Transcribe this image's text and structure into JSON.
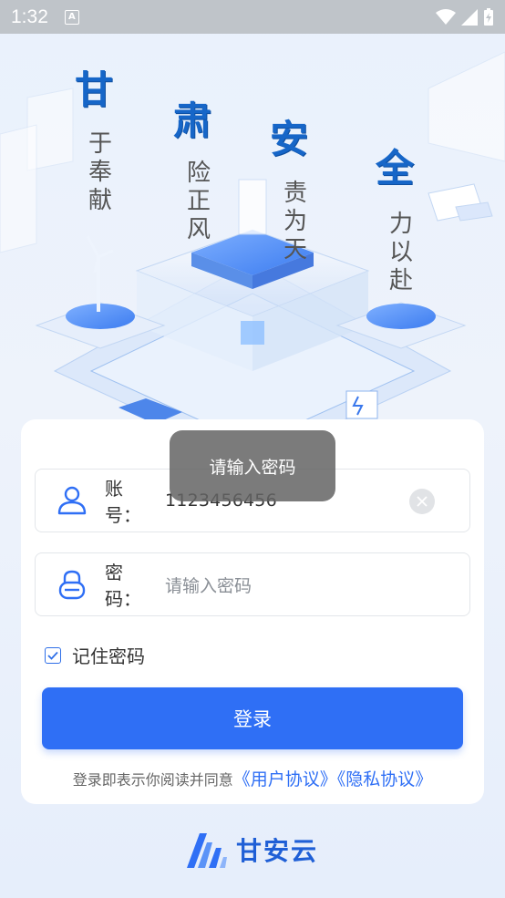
{
  "status_bar": {
    "time": "1:32",
    "notification_icon": "A"
  },
  "slogans": [
    {
      "brush": "甘",
      "text": [
        "于",
        "奉",
        "献"
      ]
    },
    {
      "brush": "肃",
      "text": [
        "险",
        "正",
        "风"
      ]
    },
    {
      "brush": "安",
      "text": [
        "责",
        "为",
        "天"
      ]
    },
    {
      "brush": "全",
      "text": [
        "力",
        "以",
        "赴"
      ]
    }
  ],
  "form": {
    "account_label": "账号：",
    "account_value": "1123456456",
    "password_label": "密码：",
    "password_placeholder": "请输入密码",
    "remember_label": "记住密码",
    "remember_checked": true,
    "login_button": "登录",
    "agreement_prefix": "登录即表示你阅读并同意",
    "user_agreement": "《用户协议》",
    "privacy_agreement": "《隐私协议》"
  },
  "toast": {
    "message": "请输入密码"
  },
  "footer": {
    "app_name": "甘安云"
  },
  "colors": {
    "primary": "#2f6ff5",
    "brush": "#1666c8"
  }
}
